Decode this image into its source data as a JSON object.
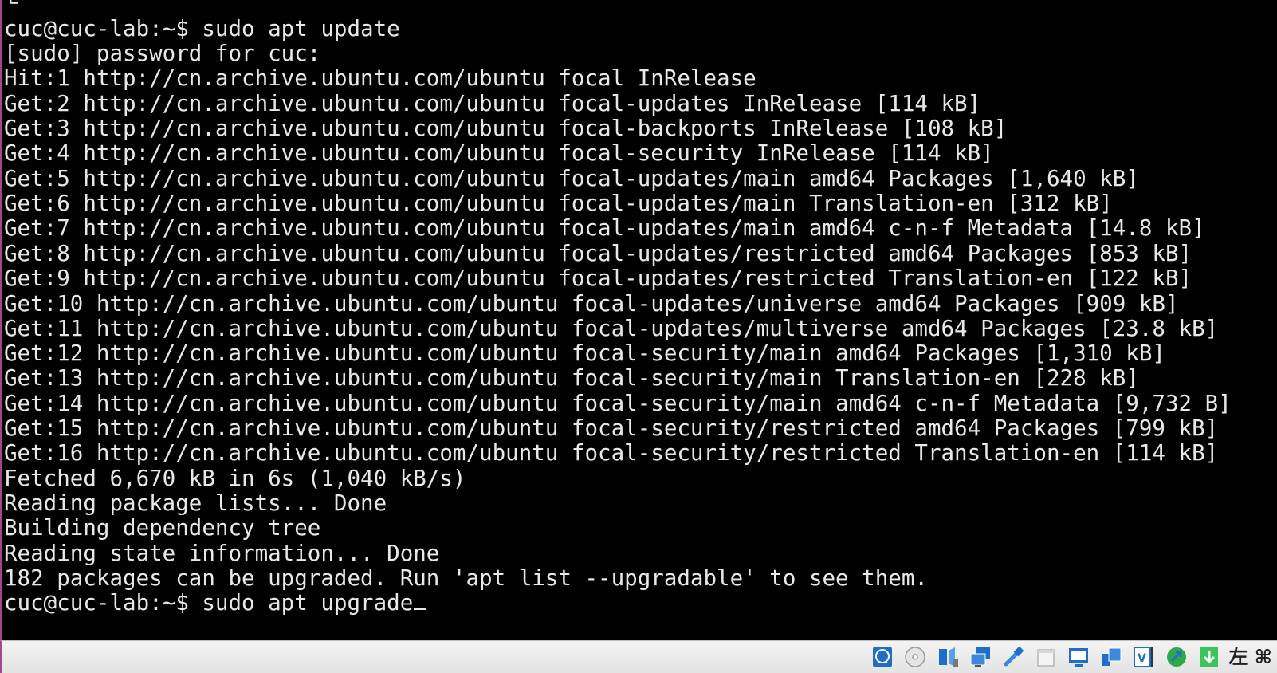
{
  "terminal": {
    "lines": [
      "└",
      "cuc@cuc-lab:~$ sudo apt update",
      "[sudo] password for cuc:",
      "Hit:1 http://cn.archive.ubuntu.com/ubuntu focal InRelease",
      "Get:2 http://cn.archive.ubuntu.com/ubuntu focal-updates InRelease [114 kB]",
      "Get:3 http://cn.archive.ubuntu.com/ubuntu focal-backports InRelease [108 kB]",
      "Get:4 http://cn.archive.ubuntu.com/ubuntu focal-security InRelease [114 kB]",
      "Get:5 http://cn.archive.ubuntu.com/ubuntu focal-updates/main amd64 Packages [1,640 kB]",
      "Get:6 http://cn.archive.ubuntu.com/ubuntu focal-updates/main Translation-en [312 kB]",
      "Get:7 http://cn.archive.ubuntu.com/ubuntu focal-updates/main amd64 c-n-f Metadata [14.8 kB]",
      "Get:8 http://cn.archive.ubuntu.com/ubuntu focal-updates/restricted amd64 Packages [853 kB]",
      "Get:9 http://cn.archive.ubuntu.com/ubuntu focal-updates/restricted Translation-en [122 kB]",
      "Get:10 http://cn.archive.ubuntu.com/ubuntu focal-updates/universe amd64 Packages [909 kB]",
      "Get:11 http://cn.archive.ubuntu.com/ubuntu focal-updates/multiverse amd64 Packages [23.8 kB]",
      "Get:12 http://cn.archive.ubuntu.com/ubuntu focal-security/main amd64 Packages [1,310 kB]",
      "Get:13 http://cn.archive.ubuntu.com/ubuntu focal-security/main Translation-en [228 kB]",
      "Get:14 http://cn.archive.ubuntu.com/ubuntu focal-security/main amd64 c-n-f Metadata [9,732 B]",
      "Get:15 http://cn.archive.ubuntu.com/ubuntu focal-security/restricted amd64 Packages [799 kB]",
      "Get:16 http://cn.archive.ubuntu.com/ubuntu focal-security/restricted Translation-en [114 kB]",
      "Fetched 6,670 kB in 6s (1,040 kB/s)",
      "Reading package lists... Done",
      "Building dependency tree",
      "Reading state information... Done",
      "182 packages can be upgraded. Run 'apt list --upgradable' to see them.",
      "cuc@cuc-lab:~$ sudo apt upgrade"
    ]
  },
  "statusbar": {
    "host_key_label": "左 ⌘",
    "icons": [
      "network-globe-icon",
      "optical-disk-icon",
      "audio-icon",
      "network-adapter-icon",
      "usb-icon",
      "shared-folder-icon",
      "display-icon",
      "recording-icon",
      "virtualization-icon",
      "mouse-integration-icon",
      "keyboard-capture-icon"
    ]
  },
  "colors": {
    "terminal_bg": "#000000",
    "terminal_fg": "#e8e8e8",
    "statusbar_bg": "#ebebeb",
    "window_frame": "#a0488a",
    "icon_blue": "#1f6fc9",
    "icon_green": "#2fa84a"
  }
}
